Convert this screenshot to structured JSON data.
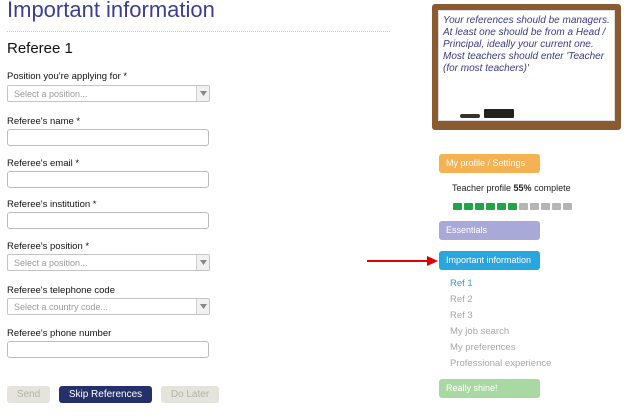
{
  "header": {
    "title": "Important information"
  },
  "form": {
    "section_title": "Referee 1",
    "fields": {
      "position_applying": {
        "label": "Position you're applying for *",
        "placeholder": "Select a position..."
      },
      "name": {
        "label": "Referee's name *",
        "value": ""
      },
      "email": {
        "label": "Referee's email *",
        "value": ""
      },
      "institution": {
        "label": "Referee's institution *",
        "value": ""
      },
      "referee_position": {
        "label": "Referee's position *",
        "placeholder": "Select a position..."
      },
      "telephone_code": {
        "label": "Referee's telephone code",
        "placeholder": "Select a country code..."
      },
      "phone_number": {
        "label": "Referee's phone number",
        "value": ""
      }
    },
    "buttons": {
      "send": "Send",
      "skip": "Skip References",
      "later": "Do Later"
    }
  },
  "blackboard": {
    "text": "Your references should be managers. At least one should be from a Head / Principal, ideally your current one. Most teachers should enter 'Teacher (for most teachers)'"
  },
  "sidebar": {
    "profile_settings": "My profile / Settings",
    "profile_status_prefix": "Teacher profile ",
    "profile_percent_text": "55%",
    "profile_status_suffix": " complete",
    "progress": {
      "filled_segments": 6,
      "total_segments": 11
    },
    "essentials": "Essentials",
    "important_information": "Important information",
    "sub_items": [
      "Ref 1",
      "Ref 2",
      "Ref 3",
      "My job search",
      "My preferences",
      "Professional experience"
    ],
    "active_sub_item": "Ref 1",
    "really_shine": "Really shine!"
  },
  "colors": {
    "title": "#3b3f93",
    "skip_button": "#23306a",
    "profile_pill": "#f4b253",
    "essentials_pill": "#a9a9d9",
    "important_pill": "#2aa6df",
    "shine_pill": "#a8d9a2",
    "progress_filled": "#1fa545",
    "arrow": "#e00000"
  }
}
